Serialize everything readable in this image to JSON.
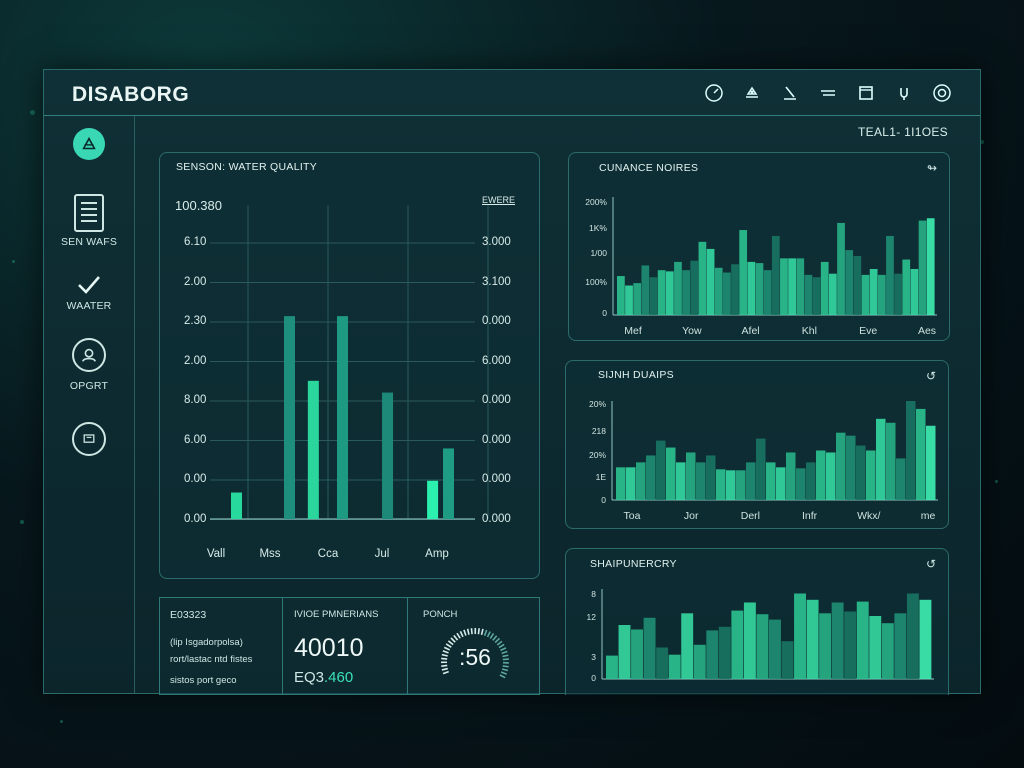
{
  "app": {
    "title": "DISABORG"
  },
  "header": {
    "icons": [
      "gauge-icon",
      "pump-icon",
      "valve-icon",
      "flow-icon",
      "window-icon",
      "power-icon",
      "settings-icon"
    ],
    "right_label": "TEAL1- 1I1OES"
  },
  "sidebar": {
    "items": [
      {
        "label": "",
        "icon": "logo-icon"
      },
      {
        "label": "SEN WAFS",
        "icon": "document-icon"
      },
      {
        "label": "WAATER",
        "icon": "checkmark-icon"
      },
      {
        "label": "OPGRT",
        "icon": "user-icon"
      },
      {
        "label": "",
        "icon": "dashboard-icon"
      }
    ]
  },
  "main_panel": {
    "title": "SENSON: WATER QUALITY",
    "left_top": "100.380",
    "right_top": "EWERE",
    "left_ticks": [
      "6.10",
      "2.00",
      "2.30",
      "2.00",
      "8.00",
      "6.00",
      "0.00",
      "0.00"
    ],
    "right_ticks": [
      "3.000",
      "3.100",
      "0.000",
      "6.000",
      "0.000",
      "0.000",
      "0.000",
      "0.000"
    ],
    "x_labels": [
      "Vall",
      "Mss",
      "Cca",
      "Jul",
      "Amp"
    ]
  },
  "bottom": {
    "cell1": {
      "title": "E03323",
      "lines": [
        "(lip Isgadorpolsa)",
        "rort/lastac ntd fistes",
        "sistos port geco"
      ]
    },
    "cell2": {
      "title": "IVIOE PMNERIANS",
      "value": "40010",
      "sub": "EQ3.460"
    },
    "cell3": {
      "title": "PONCH",
      "value": ":56"
    }
  },
  "panels": {
    "p1": {
      "title": "CUNANCE NOIRES",
      "y_ticks": [
        "200%",
        "1K%",
        "1/00",
        "100%",
        "0"
      ],
      "x_labels": [
        "Mef",
        "Yow",
        "Afel",
        "Khl",
        "Eve",
        "Aes"
      ]
    },
    "p2": {
      "title": "SIJNH DUAIPS",
      "y_ticks": [
        "20%",
        "218",
        "20%",
        "1E",
        "0"
      ],
      "x_labels": [
        "Toa",
        "Jor",
        "Derl",
        "Infr",
        "Wkx/",
        "me"
      ]
    },
    "p3": {
      "title": "SHAIPUNERCRY",
      "y_ticks": [
        "8",
        "12",
        "3",
        "0"
      ]
    }
  },
  "chart_data": [
    {
      "type": "bar",
      "title": "SENSON: WATER QUALITY",
      "ylim": [
        0,
        8
      ],
      "series": [
        {
          "name": "",
          "values": [
            0.9,
            0,
            6.8,
            0,
            0,
            0
          ],
          "color": "#27d79b"
        },
        {
          "name": "",
          "values": [
            0,
            0,
            0,
            4.6,
            0,
            0
          ],
          "color": "#2bc79a"
        },
        {
          "name": "",
          "values": [
            0,
            0,
            6.8,
            4.3,
            1.3,
            2.4
          ],
          "color": "#1d8d7b"
        }
      ],
      "bars": [
        {
          "x": 0.1,
          "h": 0.09,
          "c": "#27d99c"
        },
        {
          "x": 0.3,
          "h": 0.69,
          "c": "#1f8f7d"
        },
        {
          "x": 0.39,
          "h": 0.47,
          "c": "#2ad69b"
        },
        {
          "x": 0.5,
          "h": 0.69,
          "c": "#1f9a82"
        },
        {
          "x": 0.67,
          "h": 0.43,
          "c": "#1d8a79"
        },
        {
          "x": 0.84,
          "h": 0.13,
          "c": "#2cf0ad"
        },
        {
          "x": 0.9,
          "h": 0.24,
          "c": "#1f9c84"
        }
      ]
    },
    {
      "type": "bar",
      "title": "CUNANCE NOIRES",
      "ylim": [
        0,
        1
      ],
      "values": [
        0.33,
        0.25,
        0.27,
        0.42,
        0.32,
        0.38,
        0.37,
        0.45,
        0.38,
        0.46,
        0.62,
        0.56,
        0.4,
        0.36,
        0.43,
        0.72,
        0.45,
        0.44,
        0.38,
        0.67,
        0.48,
        0.48,
        0.48,
        0.34,
        0.32,
        0.45,
        0.35,
        0.78,
        0.55,
        0.5,
        0.34,
        0.39,
        0.34,
        0.67,
        0.35,
        0.47,
        0.39,
        0.8,
        0.82
      ]
    },
    {
      "type": "bar",
      "title": "SIJNH DUAIPS",
      "ylim": [
        0,
        1
      ],
      "values": [
        0.33,
        0.33,
        0.38,
        0.45,
        0.6,
        0.53,
        0.38,
        0.48,
        0.38,
        0.45,
        0.31,
        0.3,
        0.3,
        0.38,
        0.62,
        0.38,
        0.33,
        0.48,
        0.32,
        0.38,
        0.5,
        0.48,
        0.68,
        0.65,
        0.55,
        0.5,
        0.82,
        0.78,
        0.42,
        1.0,
        0.92,
        0.75
      ]
    },
    {
      "type": "bar",
      "title": "SHAIPUNERCRY",
      "ylim": [
        0,
        1
      ],
      "values": [
        0.26,
        0.6,
        0.55,
        0.68,
        0.35,
        0.27,
        0.73,
        0.38,
        0.54,
        0.58,
        0.76,
        0.85,
        0.72,
        0.66,
        0.42,
        0.95,
        0.88,
        0.73,
        0.85,
        0.75,
        0.86,
        0.7,
        0.62,
        0.73,
        0.95,
        0.88
      ]
    }
  ]
}
